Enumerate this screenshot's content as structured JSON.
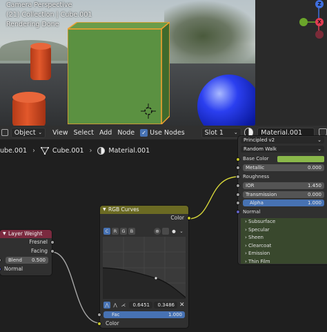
{
  "viewport": {
    "line1": "Camera Perspective",
    "line2": "(21) Collection | Cube.001",
    "line3": "Rendering Done"
  },
  "gizmo": {
    "z_label": "Z",
    "x_label": "X",
    "y_label": "Y"
  },
  "header": {
    "mode": "Object",
    "menu_view": "View",
    "menu_select": "Select",
    "menu_add": "Add",
    "menu_node": "Node",
    "use_nodes_label": "Use Nodes",
    "use_nodes_checked": "✓",
    "slot": "Slot 1",
    "material": "Material.001"
  },
  "breadcrumb": {
    "object": "ube.001",
    "mesh": "Cube.001",
    "material": "Material.001"
  },
  "layer_weight": {
    "title": "Layer Weight",
    "out_fresnel": "Fresnel",
    "out_facing": "Facing",
    "blend_label": "Blend",
    "blend_value": "0.500",
    "normal_label": "Normal"
  },
  "rgb_curves": {
    "title": "RGB Curves",
    "out_color": "Color",
    "tabs": [
      "C",
      "R",
      "G",
      "B"
    ],
    "point_x": "0.6451",
    "point_y": "0.3486",
    "fac_label": "Fac",
    "fac_value": "1.000",
    "in_color": "Color"
  },
  "bsdf": {
    "distribution": "Principled v2",
    "subsurface_method": "Random Walk",
    "base_color_label": "Base Color",
    "base_color_hex": "#8ab84a",
    "metallic_label": "Metallic",
    "metallic_value": "0.000",
    "roughness_label": "Roughness",
    "ior_label": "IOR",
    "ior_value": "1.450",
    "transmission_label": "Transmission",
    "transmission_value": "0.000",
    "alpha_label": "Alpha",
    "alpha_value": "1.000",
    "normal_label": "Normal",
    "panels": [
      "Subsurface",
      "Specular",
      "Sheen",
      "Clearcoat",
      "Emission",
      "Thin Film"
    ]
  },
  "colors": {
    "accent": "#4772b3",
    "socket_color": "#c7c729",
    "socket_float": "#a1a1a1",
    "socket_vector": "#6363c7",
    "layer_weight_header": "#7b2a3f",
    "rgb_curves_header": "#6b6a23",
    "selection_outline": "#f0a030"
  }
}
